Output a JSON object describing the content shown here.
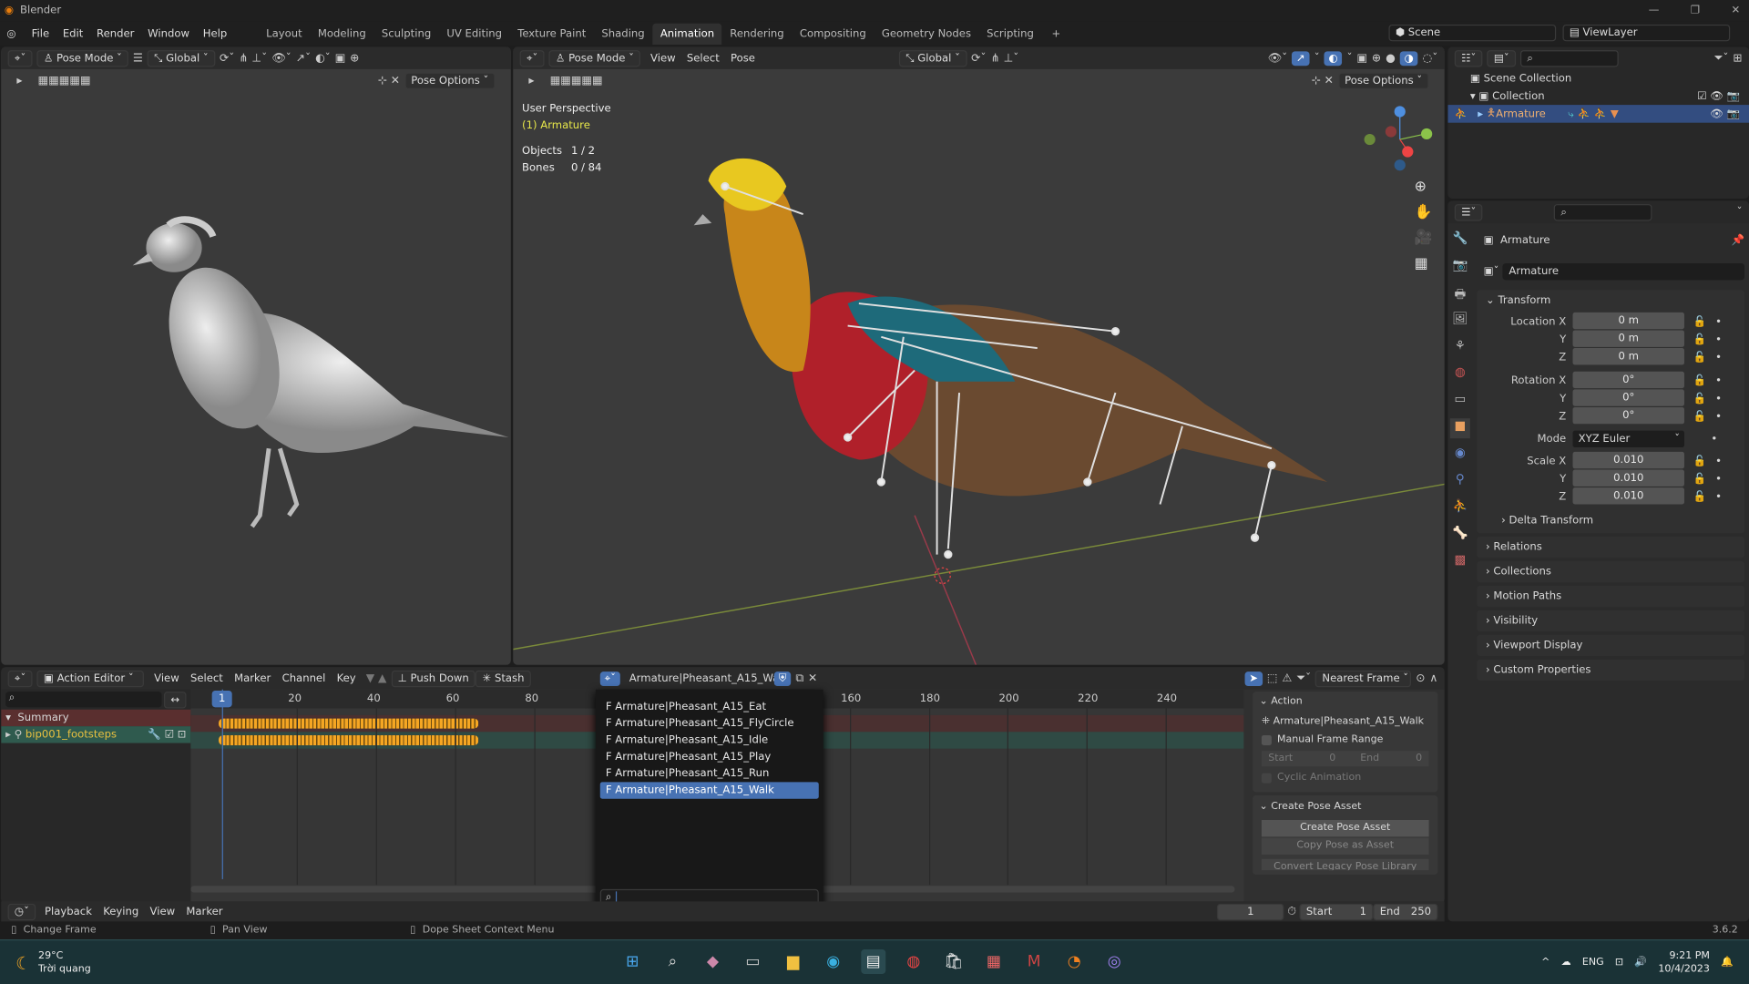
{
  "app": {
    "title": "Blender",
    "version": "3.6.2"
  },
  "menu": [
    "File",
    "Edit",
    "Render",
    "Window",
    "Help"
  ],
  "workspaces": [
    {
      "label": "Layout"
    },
    {
      "label": "Modeling"
    },
    {
      "label": "Sculpting"
    },
    {
      "label": "UV Editing"
    },
    {
      "label": "Texture Paint"
    },
    {
      "label": "Shading"
    },
    {
      "label": "Animation",
      "active": true
    },
    {
      "label": "Rendering"
    },
    {
      "label": "Compositing"
    },
    {
      "label": "Geometry Nodes"
    },
    {
      "label": "Scripting"
    }
  ],
  "scene": {
    "name": "Scene",
    "view_layer": "ViewLayer"
  },
  "left_viewport": {
    "mode": "Pose Mode",
    "orientation": "Global",
    "pose_options": "Pose Options"
  },
  "right_viewport": {
    "mode": "Pose Mode",
    "menus": [
      "View",
      "Select",
      "Pose"
    ],
    "orientation": "Global",
    "pose_options": "Pose Options",
    "overlay": {
      "perspective": "User Perspective",
      "active": "(1) Armature",
      "objects_label": "Objects",
      "objects_value": "1 / 2",
      "bones_label": "Bones",
      "bones_value": "0 / 84"
    }
  },
  "outliner": {
    "items": [
      {
        "label": "Scene Collection"
      },
      {
        "label": "Collection"
      },
      {
        "label": "Armature",
        "selected": true
      }
    ]
  },
  "properties": {
    "object_name": "Armature",
    "datablock": "Armature",
    "transform_label": "Transform",
    "location": {
      "label": "Location X",
      "x": "0 m",
      "y": "0 m",
      "z": "0 m"
    },
    "rotation": {
      "label": "Rotation X",
      "x": "0°",
      "y": "0°",
      "z": "0°"
    },
    "mode": {
      "label": "Mode",
      "value": "XYZ Euler"
    },
    "scale": {
      "label": "Scale X",
      "x": "0.010",
      "y": "0.010",
      "z": "0.010"
    },
    "axis": {
      "y": "Y",
      "z": "Z"
    },
    "delta": "Delta Transform",
    "panels": [
      "Relations",
      "Collections",
      "Motion Paths",
      "Visibility",
      "Viewport Display",
      "Custom Properties"
    ]
  },
  "dopesheet": {
    "editor": "Action Editor",
    "menus": [
      "View",
      "Select",
      "Marker",
      "Channel",
      "Key"
    ],
    "push_down": "Push Down",
    "stash": "Stash",
    "action": "Armature|Pheasant_A15_Walk",
    "snap": "Nearest Frame",
    "current_frame": "1",
    "ticks": [
      "20",
      "40",
      "60",
      "80",
      "160",
      "180",
      "200",
      "220",
      "240"
    ],
    "channels": [
      {
        "label": "Summary"
      },
      {
        "label": "bip001_footsteps"
      }
    ],
    "keyframe_range": [
      1,
      65
    ],
    "action_list": [
      "F Armature|Pheasant_A15_Eat",
      "F Armature|Pheasant_A15_FlyCircle",
      "F Armature|Pheasant_A15_Idle",
      "F Armature|Pheasant_A15_Play",
      "F Armature|Pheasant_A15_Run",
      "F Armature|Pheasant_A15_Walk"
    ],
    "action_list_selected": 5,
    "search_value": "",
    "side": {
      "action_header": "Action",
      "action_name": "Armature|Pheasant_A15_Walk",
      "manual_range": "Manual Frame Range",
      "start_label": "Start",
      "start_value": "0",
      "end_label": "End",
      "end_value": "0",
      "cyclic": "Cyclic Animation",
      "pose_header": "Create Pose Asset",
      "create_pose": "Create Pose Asset",
      "copy_pose": "Copy Pose as Asset",
      "convert": "Convert Legacy Pose Library"
    }
  },
  "timeline": {
    "menus": [
      "Playback",
      "Keying",
      "View",
      "Marker"
    ],
    "frame": "1",
    "start_label": "Start",
    "start": "1",
    "end_label": "End",
    "end": "250"
  },
  "status": [
    "Change Frame",
    "Pan View",
    "Dope Sheet Context Menu"
  ],
  "taskbar": {
    "temp": "29°C",
    "weather": "Trời quang",
    "lang": "ENG",
    "time": "9:21 PM",
    "date": "10/4/2023"
  },
  "colors": {
    "accent": "#4772b3",
    "summary_row": "#5a2f2f",
    "channel_row": "#2f5a4e",
    "keyframe": "#f5a623"
  }
}
